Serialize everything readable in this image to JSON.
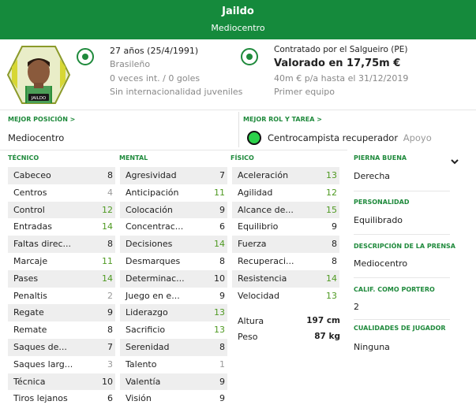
{
  "header": {
    "name": "Jaildo",
    "position": "Mediocentro",
    "color": "#158a3c"
  },
  "portrait": {
    "name_tag": "JAILDO"
  },
  "personal": {
    "age": "27 años (25/4/1991)",
    "nationality": "Brasileño",
    "caps": "0 veces int. / 0 goles",
    "youth": "Sin internacionalidad juveniles"
  },
  "contract": {
    "club": "Contratado por el Salgueiro (PE)",
    "value": "Valorado en 17,75m €",
    "wage": "40m € p/a hasta el 31/12/2019",
    "squad": "Primer equipo"
  },
  "best_position": {
    "label": "MEJOR POSICIÓN >",
    "value": "Mediocentro"
  },
  "best_role": {
    "label": "MEJOR ROL Y TAREA >",
    "role": "Centrocampista recuperador",
    "duty": "Apoyo"
  },
  "tecnico": {
    "title": "TÉCNICO",
    "rows": [
      {
        "label": "Cabeceo",
        "value": "8",
        "level": "mid"
      },
      {
        "label": "Centros",
        "value": "4",
        "level": "lo"
      },
      {
        "label": "Control",
        "value": "12",
        "level": "hi"
      },
      {
        "label": "Entradas",
        "value": "14",
        "level": "hi"
      },
      {
        "label": "Faltas direc...",
        "value": "8",
        "level": "mid"
      },
      {
        "label": "Marcaje",
        "value": "11",
        "level": "hi"
      },
      {
        "label": "Pases",
        "value": "14",
        "level": "hi"
      },
      {
        "label": "Penaltis",
        "value": "2",
        "level": "lo"
      },
      {
        "label": "Regate",
        "value": "9",
        "level": "mid"
      },
      {
        "label": "Remate",
        "value": "8",
        "level": "mid"
      },
      {
        "label": "Saques de...",
        "value": "7",
        "level": "mid"
      },
      {
        "label": "Saques larg...",
        "value": "3",
        "level": "lo"
      },
      {
        "label": "Técnica",
        "value": "10",
        "level": "mid"
      },
      {
        "label": "Tiros lejanos",
        "value": "6",
        "level": "mid"
      }
    ]
  },
  "mental": {
    "title": "MENTAL",
    "rows": [
      {
        "label": "Agresividad",
        "value": "7",
        "level": "mid"
      },
      {
        "label": "Anticipación",
        "value": "11",
        "level": "hi"
      },
      {
        "label": "Colocación",
        "value": "9",
        "level": "mid"
      },
      {
        "label": "Concentrac...",
        "value": "6",
        "level": "mid"
      },
      {
        "label": "Decisiones",
        "value": "14",
        "level": "hi"
      },
      {
        "label": "Desmarques",
        "value": "8",
        "level": "mid"
      },
      {
        "label": "Determinac...",
        "value": "10",
        "level": "mid"
      },
      {
        "label": "Juego en e...",
        "value": "9",
        "level": "mid"
      },
      {
        "label": "Liderazgo",
        "value": "13",
        "level": "hi"
      },
      {
        "label": "Sacrificio",
        "value": "13",
        "level": "hi"
      },
      {
        "label": "Serenidad",
        "value": "8",
        "level": "mid"
      },
      {
        "label": "Talento",
        "value": "1",
        "level": "lo"
      },
      {
        "label": "Valentía",
        "value": "9",
        "level": "mid"
      },
      {
        "label": "Visión",
        "value": "9",
        "level": "mid"
      }
    ]
  },
  "fisico": {
    "title": "FÍSICO",
    "rows": [
      {
        "label": "Aceleración",
        "value": "13",
        "level": "hi"
      },
      {
        "label": "Agilidad",
        "value": "12",
        "level": "hi"
      },
      {
        "label": "Alcance de...",
        "value": "15",
        "level": "hi"
      },
      {
        "label": "Equilibrio",
        "value": "9",
        "level": "mid"
      },
      {
        "label": "Fuerza",
        "value": "8",
        "level": "mid"
      },
      {
        "label": "Recuperaci...",
        "value": "8",
        "level": "mid"
      },
      {
        "label": "Resistencia",
        "value": "14",
        "level": "hi"
      },
      {
        "label": "Velocidad",
        "value": "13",
        "level": "hi"
      }
    ],
    "altura_label": "Altura",
    "altura": "197 cm",
    "peso_label": "Peso",
    "peso": "87 kg"
  },
  "side": {
    "foot_label": "PIERNA BUENA",
    "foot": "Derecha",
    "personality_label": "PERSONALIDAD",
    "personality": "Equilibrado",
    "press_label": "DESCRIPCIÓN DE LA PRENSA",
    "press": "Mediocentro",
    "gk_label": "CALIF. COMO PORTERO",
    "gk": "2",
    "qualities_label": "CUALIDADES DE JUGADOR",
    "qualities": "Ninguna"
  }
}
